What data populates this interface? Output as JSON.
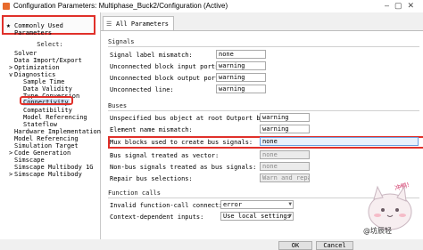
{
  "window": {
    "title": "Configuration Parameters: Multiphase_Buck2/Configuration (Active)"
  },
  "favorites": {
    "label": "Commonly Used Parameters"
  },
  "all_tab": {
    "label": "All Parameters"
  },
  "tree": {
    "header": "Select:",
    "items": [
      "Solver",
      "Data Import/Export",
      "Optimization",
      "Diagnostics",
      "Sample Time",
      "Data Validity",
      "Type Conversion",
      "Connectivity",
      "Compatibility",
      "Model Referencing",
      "Stateflow",
      "Hardware Implementation",
      "Model Referencing",
      "Simulation Target",
      "Code Generation",
      "Simscape",
      "Simscape Multibody 1G",
      "Simscape Multibody"
    ]
  },
  "signals": {
    "heading": "Signals",
    "rows": [
      {
        "label": "Signal label mismatch:",
        "value": "none"
      },
      {
        "label": "Unconnected block input ports:",
        "value": "warning"
      },
      {
        "label": "Unconnected block output ports:",
        "value": "warning"
      },
      {
        "label": "Unconnected line:",
        "value": "warning"
      }
    ]
  },
  "buses": {
    "heading": "Buses",
    "rows": [
      {
        "label": "Unspecified bus object at root Outport block:",
        "value": "warning"
      },
      {
        "label": "Element name mismatch:",
        "value": "warning"
      },
      {
        "label": "Mux blocks used to create bus signals:",
        "value": "none"
      },
      {
        "label": "Bus signal treated as vector:",
        "value": "none"
      },
      {
        "label": "Non-bus signals treated as bus signals:",
        "value": "none"
      },
      {
        "label": "Repair bus selections:",
        "value": "Warn and repair"
      }
    ]
  },
  "function_calls": {
    "heading": "Function calls",
    "rows": [
      {
        "label": "Invalid function-call connection:",
        "value": "error"
      },
      {
        "label": "Context-dependent inputs:",
        "value": "Use local settings"
      }
    ]
  },
  "buttons": {
    "ok": "OK",
    "cancel": "Cancel"
  },
  "icons": {
    "star": "star-icon",
    "table": "table-icon",
    "dropdown": "chevron-down-icon"
  },
  "colors": {
    "highlight_red": "#e0302a",
    "selection_blue": "#cfe0f4"
  }
}
